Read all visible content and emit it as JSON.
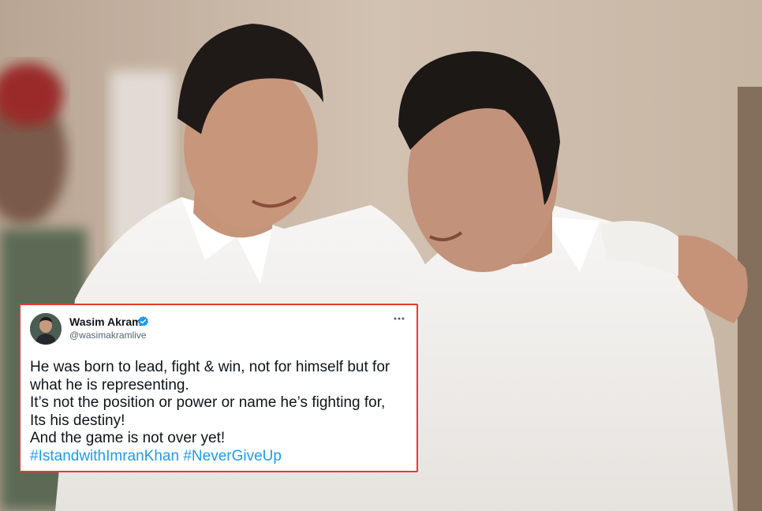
{
  "tweet": {
    "author_name": "Wasim Akram",
    "handle": "@wasimakramlive",
    "verified": true,
    "lines": [
      "He was born to lead, fight & win, not for himself but for",
      "what he is representing.",
      "It’s not the position or power or name he’s fighting for,",
      "Its his destiny!",
      "And the game is not over yet!"
    ],
    "hashtags": [
      "#IstandwithImranKhan",
      "#NeverGiveUp"
    ]
  },
  "colors": {
    "card_border": "#e53935",
    "hashtag": "#1d9bf0",
    "verified_badge": "#1d9bf0",
    "background_wall": "#cbb8a6"
  },
  "icons": {
    "verified": "verified-badge-icon",
    "more": "more-horizontal-icon"
  }
}
